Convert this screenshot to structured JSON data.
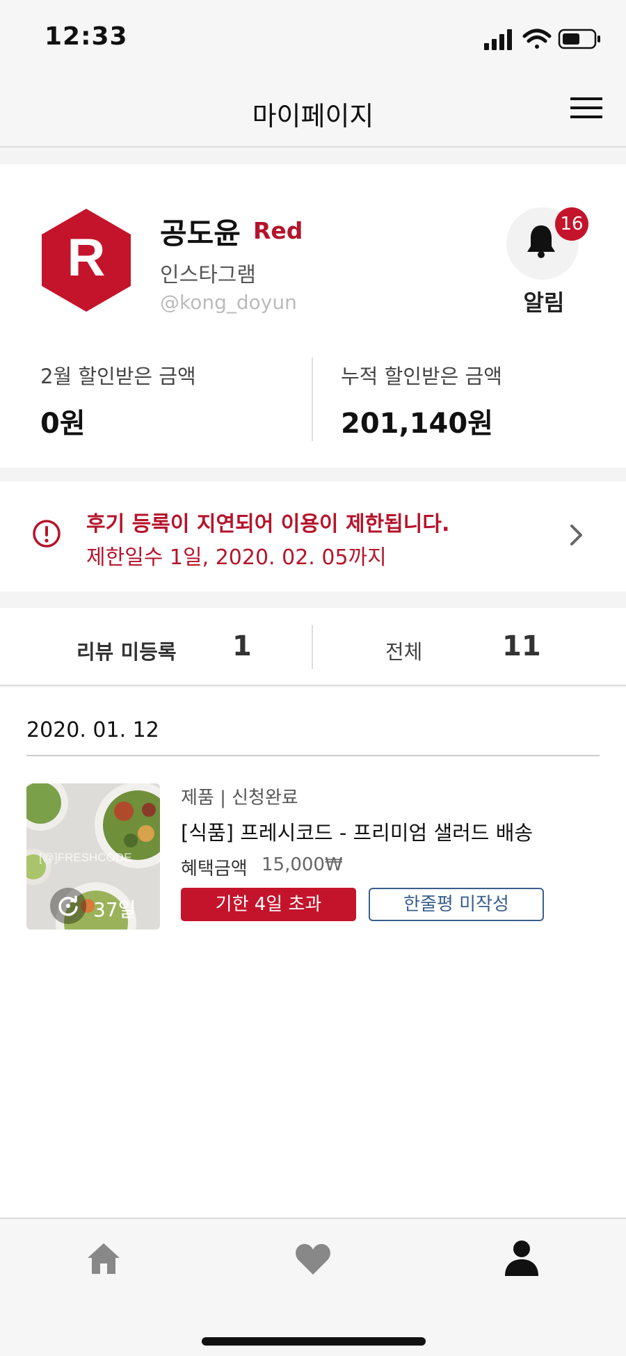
{
  "status_bar": {
    "time": "12:33"
  },
  "header": {
    "title": "마이페이지"
  },
  "profile": {
    "avatar_letter": "R",
    "name": "공도윤",
    "grade": "Red",
    "sns": "인스타그램",
    "handle": "@kong_doyun",
    "notification_count": "16",
    "notification_label": "알림"
  },
  "stats": {
    "monthly_label": "2월 할인받은 금액",
    "monthly_value": "0원",
    "total_label": "누적 할인받은 금액",
    "total_value": "201,140원"
  },
  "warning": {
    "title": "후기 등록이 지연되어 이용이 제한됩니다.",
    "subtitle": "제한일수 1일, 2020. 02. 05까지"
  },
  "review_counts": {
    "unregistered_label": "리뷰 미등록",
    "unregistered_value": "1",
    "total_label": "전체",
    "total_value": "11"
  },
  "list": {
    "date": "2020. 01. 12",
    "items": [
      {
        "meta": "제품 | 신청완료",
        "title": "[식품] 프레시코드 - 프리미엄 샐러드 배송",
        "benefit_label": "혜택금액",
        "benefit_value": "15,000₩",
        "days": "37일",
        "overdue_tag": "기한 4일 초과",
        "review_tag": "한줄평 미작성"
      }
    ]
  },
  "colors": {
    "brand_red": "#c4142b",
    "link_blue": "#3a5e8c"
  },
  "nav_icons": [
    "home-icon",
    "heart-icon",
    "user-icon"
  ]
}
